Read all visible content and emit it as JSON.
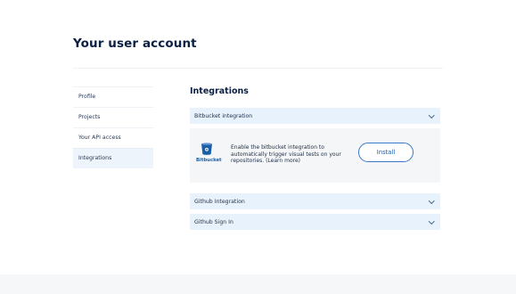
{
  "page": {
    "title": "Your user account"
  },
  "sidebar": {
    "items": [
      {
        "label": "Profile"
      },
      {
        "label": "Projects"
      },
      {
        "label": "Your API access"
      },
      {
        "label": "Integrations",
        "active": true
      }
    ]
  },
  "integrations": {
    "title": "Integrations",
    "bitbucket": {
      "header": "Bitbucket integration",
      "logo_text": "Bitbucket",
      "description": "Enable the bitbucket integration to automatically trigger visual tests on your repositories. (Learn more)",
      "install_label": "Install"
    },
    "github_integration": {
      "header": "Github Integration"
    },
    "github_signin": {
      "header": "Github Sign In"
    }
  },
  "colors": {
    "accent": "#3a78c9",
    "accordion_bg": "#e7f2fc",
    "active_item_bg": "#edf4fb"
  }
}
